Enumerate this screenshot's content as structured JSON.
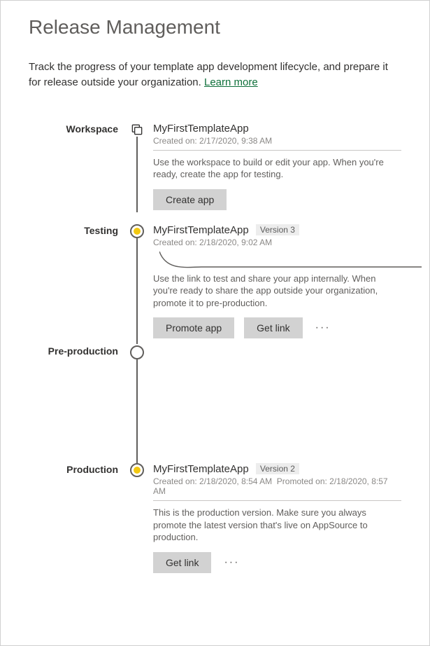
{
  "page_title": "Release Management",
  "intro_text": "Track the progress of your template app development lifecycle, and prepare it for release outside your organization. ",
  "learn_more_label": "Learn more",
  "stages": {
    "workspace": {
      "label": "Workspace",
      "app_name": "MyFirstTemplateApp",
      "created": "Created on: 2/17/2020, 9:38 AM",
      "description": "Use the workspace to build or edit your app. When you're ready, create the app for testing.",
      "button_create_app": "Create app"
    },
    "testing": {
      "label": "Testing",
      "app_name": "MyFirstTemplateApp",
      "version_pill": "Version 3",
      "created": "Created on: 2/18/2020, 9:02 AM",
      "description": "Use the link to test and share your app internally. When you're ready to share the app outside your organization, promote it to pre-production.",
      "button_promote": "Promote app",
      "button_getlink": "Get link"
    },
    "preproduction": {
      "label": "Pre-production"
    },
    "production": {
      "label": "Production",
      "app_name": "MyFirstTemplateApp",
      "version_pill": "Version 2",
      "created": "Created on: 2/18/2020, 8:54 AM",
      "promoted": "Promoted on: 2/18/2020, 8:57 AM",
      "description": "This is the production version. Make sure you always promote the latest version that's live on AppSource to production.",
      "button_getlink": "Get link"
    }
  }
}
